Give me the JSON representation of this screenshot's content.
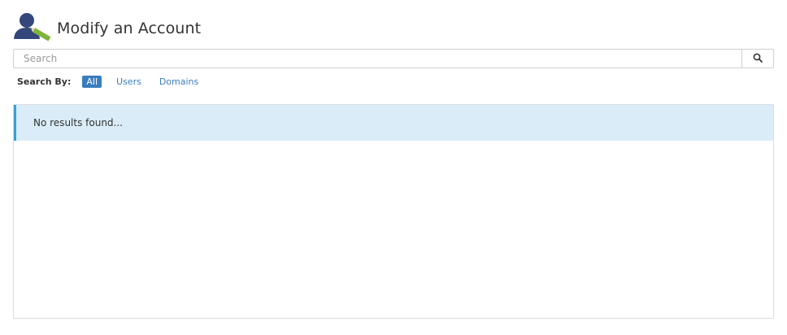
{
  "header": {
    "title": "Modify an Account",
    "icon": "user-edit-icon"
  },
  "search": {
    "placeholder": "Search",
    "button_icon": "search-icon"
  },
  "search_by": {
    "label": "Search By:",
    "options": [
      {
        "label": "All",
        "active": true
      },
      {
        "label": "Users",
        "active": false
      },
      {
        "label": "Domains",
        "active": false
      }
    ]
  },
  "results": {
    "message": "No results found..."
  },
  "colors": {
    "accent": "#3a7dbf",
    "alert_bg": "#d9ecf8",
    "alert_border": "#3a9fd5"
  }
}
